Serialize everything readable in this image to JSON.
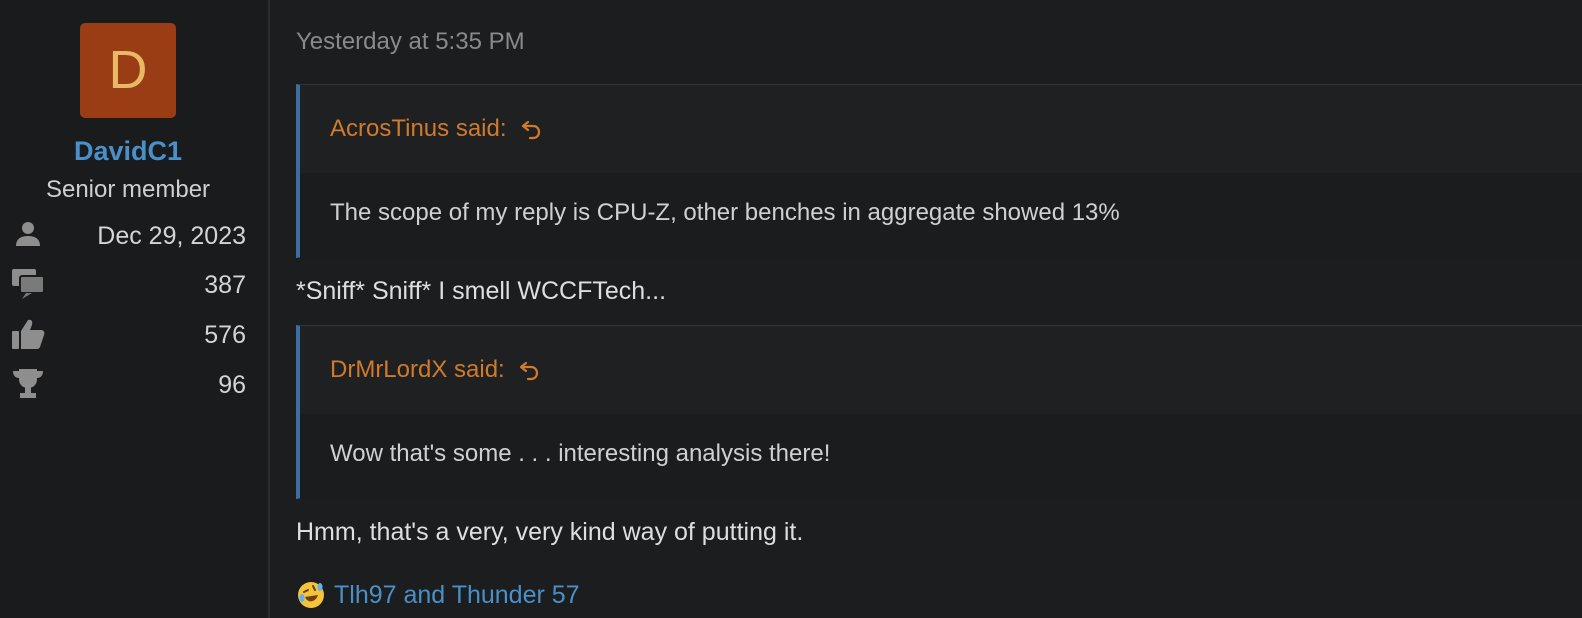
{
  "user": {
    "avatar_letter": "D",
    "name": "DavidC1",
    "title": "Senior member",
    "joined": "Dec 29, 2023",
    "messages": "387",
    "reactions": "576",
    "points": "96",
    "avatar_bg": "#9a3c14",
    "avatar_fg": "#e9b866"
  },
  "post": {
    "timestamp": "Yesterday at 5:35 PM",
    "quotes": [
      {
        "author": "AcrosTinus said:",
        "text": "The scope of my reply is CPU-Z, other benches in aggregate showed 13%"
      },
      {
        "author": "DrMrLordX said:",
        "text": "Wow that's some . . . interesting analysis there!"
      }
    ],
    "replies": [
      "*Sniff* Sniff* I smell WCCFTech...",
      "Hmm, that's a very, very kind way of putting it."
    ],
    "reaction": {
      "icon": "rolling-laughing-emoji",
      "users": "Tlh97 and Thunder 57"
    }
  },
  "colors": {
    "accent_link": "#4a90c8",
    "quote_author": "#d07a2c",
    "quote_border": "#3c6fa0"
  }
}
